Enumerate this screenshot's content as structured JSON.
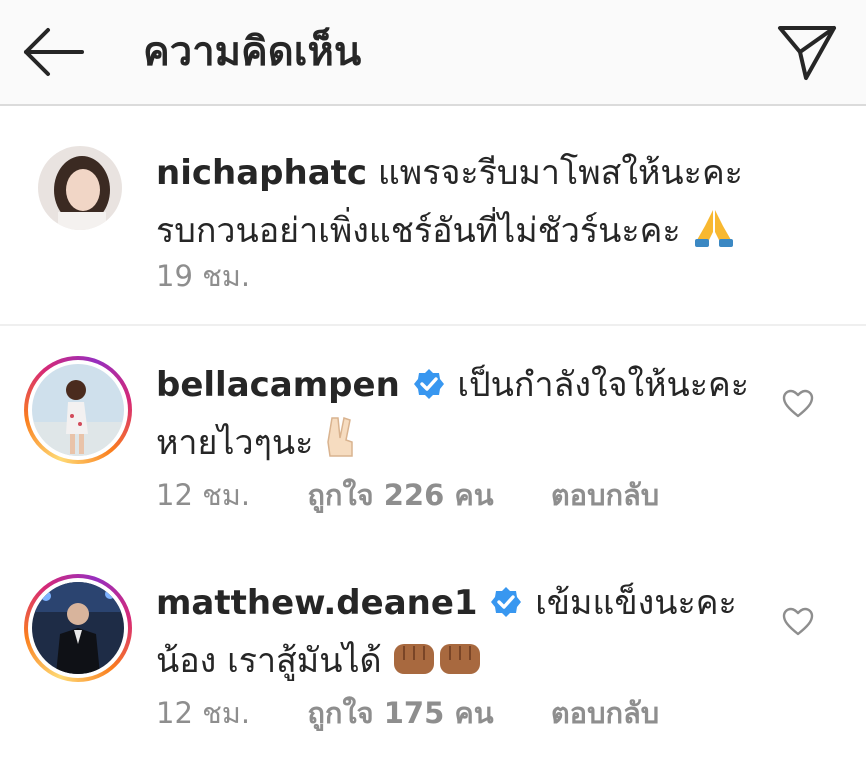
{
  "header": {
    "title": "ความคิดเห็น",
    "back_icon": "arrow-left-icon",
    "send_icon": "paper-plane-icon"
  },
  "caption": {
    "username": "nichaphatc",
    "text_line1": "แพรจะรีบมาโพสให้นะคะ",
    "text_line2": "รบกวนอย่าเพิ่งแชร์อันที่ไม่ชัวร์นะคะ",
    "emoji": "folded-hands-emoji",
    "time": "19 ชม."
  },
  "comments": [
    {
      "username": "bellacampen",
      "verified": true,
      "text_line1": "เป็นกำลังใจให้นะคะ",
      "text_line2": "หายไวๆนะ",
      "emoji": "victory-hand-emoji",
      "time": "12 ชม.",
      "likes": "ถูกใจ 226 คน",
      "reply": "ตอบกลับ"
    },
    {
      "username": "matthew.deane1",
      "verified": true,
      "text_line1": "เข้มแข็งนะคะ",
      "text_line2": "น้อง เราสู้มันได้",
      "emoji": "fist-emoji",
      "time": "12 ชม.",
      "likes": "ถูกใจ 175 คน",
      "reply": "ตอบกลับ"
    }
  ],
  "colors": {
    "text": "#262626",
    "muted": "#8e8e8e",
    "verified": "#3897f0",
    "header_bg": "#fafafa"
  }
}
